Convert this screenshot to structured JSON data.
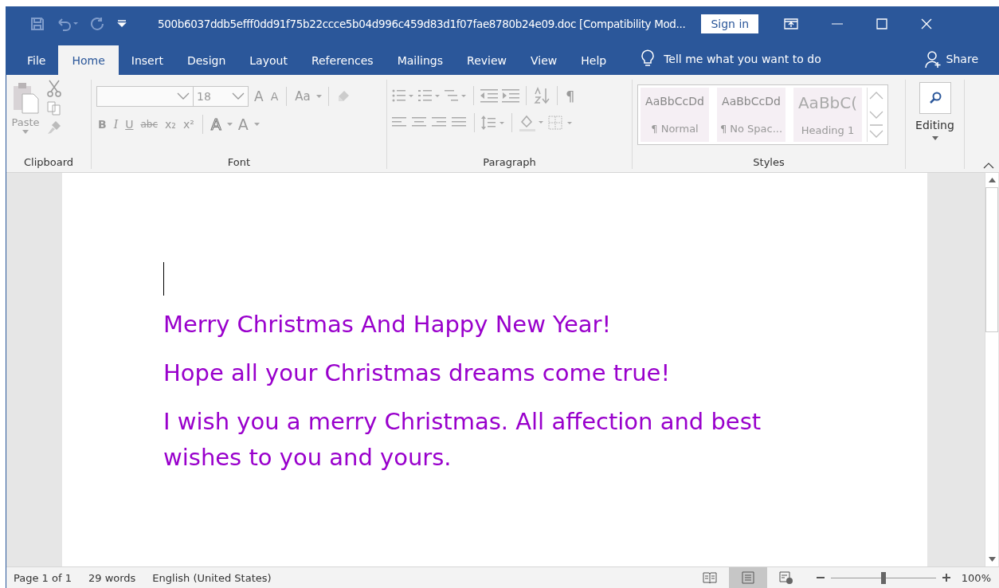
{
  "title_bar": {
    "title": "500b6037ddb5efff0dd91f75b22ccce5b04d996c459d83d1f07fae8780b24e09.doc [Compatibility Mod...",
    "sign_in": "Sign in"
  },
  "tabs": [
    {
      "label": "File",
      "selected": false
    },
    {
      "label": "Home",
      "selected": true
    },
    {
      "label": "Insert",
      "selected": false
    },
    {
      "label": "Design",
      "selected": false
    },
    {
      "label": "Layout",
      "selected": false
    },
    {
      "label": "References",
      "selected": false
    },
    {
      "label": "Mailings",
      "selected": false
    },
    {
      "label": "Review",
      "selected": false
    },
    {
      "label": "View",
      "selected": false
    },
    {
      "label": "Help",
      "selected": false
    }
  ],
  "tell_me": "Tell me what you want to do",
  "share": "Share",
  "ribbon": {
    "clipboard": {
      "paste": "Paste",
      "label": "Clipboard"
    },
    "font": {
      "size": "18",
      "grow": "A",
      "shrink": "A",
      "case": "Aa",
      "format_buttons": [
        "B",
        "I",
        "U",
        "abc",
        "x₂",
        "x²"
      ],
      "effects": "A",
      "font_color": "A",
      "label": "Font"
    },
    "paragraph": {
      "pilcrow": "¶",
      "label": "Paragraph"
    },
    "styles": {
      "items": [
        {
          "preview": "AaBbCcDd",
          "name": "¶ Normal",
          "kind": "body"
        },
        {
          "preview": "AaBbCcDd",
          "name": "¶ No Spac...",
          "kind": "body"
        },
        {
          "preview": "AaBbC(",
          "name": "Heading 1",
          "kind": "heading"
        }
      ],
      "label": "Styles"
    },
    "editing": "Editing"
  },
  "document": {
    "paragraphs": [
      "Merry Christmas And Happy New Year!",
      "Hope all your Christmas dreams come true!",
      "I wish you a merry Christmas. All affection and best wishes to you and yours."
    ]
  },
  "status_bar": {
    "page": "Page 1 of 1",
    "words": "29 words",
    "language": "English (United States)",
    "views": [
      {
        "kind": "read",
        "selected": false
      },
      {
        "kind": "print",
        "selected": true
      },
      {
        "kind": "web",
        "selected": false
      }
    ],
    "zoom": {
      "level": 0.5,
      "reading": "100%"
    }
  }
}
